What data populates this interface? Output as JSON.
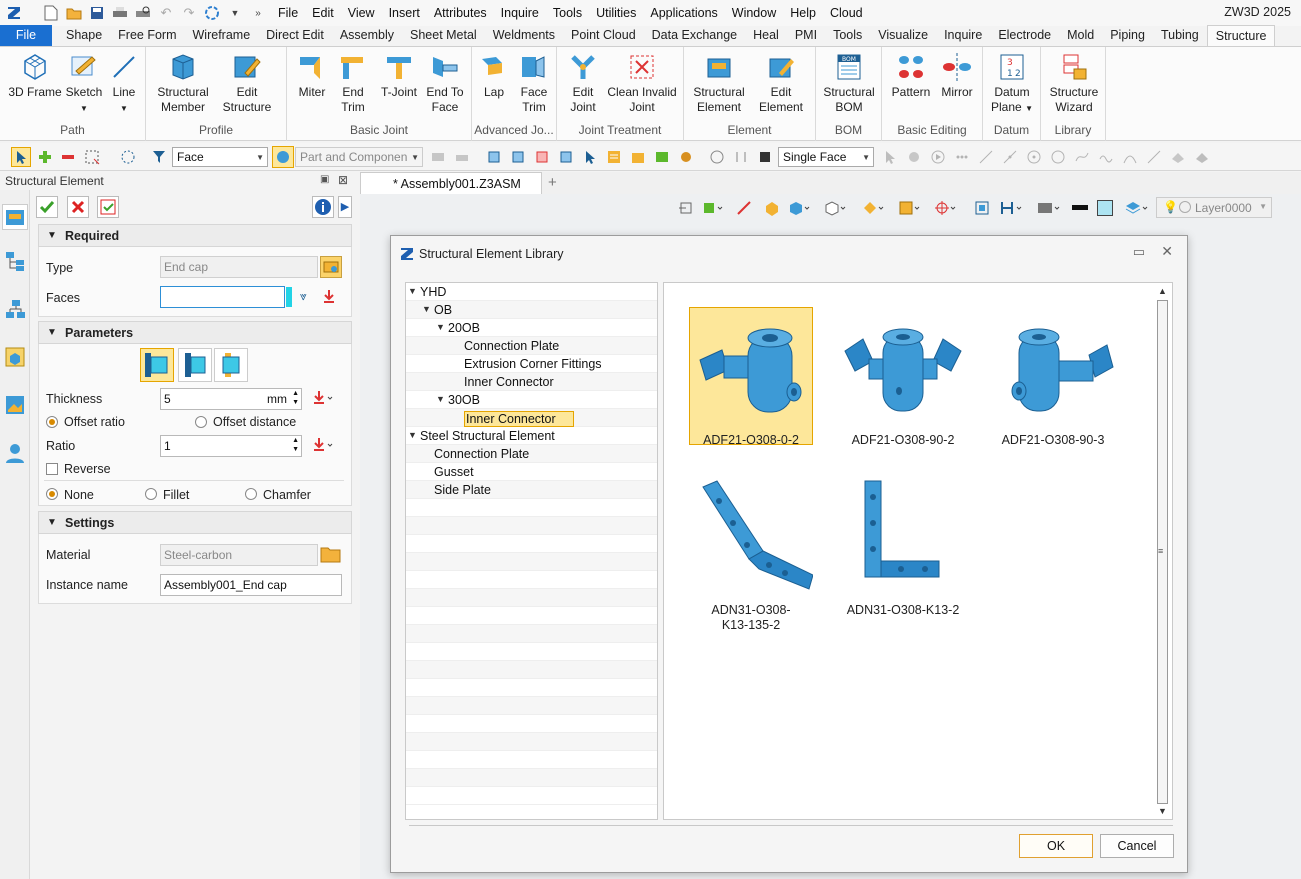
{
  "app": {
    "name": "ZW3D 2025"
  },
  "menubar": {
    "items": [
      "File",
      "Edit",
      "View",
      "Insert",
      "Attributes",
      "Inquire",
      "Tools",
      "Utilities",
      "Applications",
      "Window",
      "Help",
      "Cloud"
    ]
  },
  "ribbon_tabs": [
    "File",
    "Shape",
    "Free Form",
    "Wireframe",
    "Direct Edit",
    "Assembly",
    "Sheet Metal",
    "Weldments",
    "Point Cloud",
    "Data Exchange",
    "Heal",
    "PMI",
    "Tools",
    "Visualize",
    "Inquire",
    "Electrode",
    "Mold",
    "Piping",
    "Tubing",
    "Structure"
  ],
  "ribbon": {
    "groups": [
      {
        "name": "Path",
        "buttons": [
          "3D Frame",
          "Sketch",
          "Line"
        ]
      },
      {
        "name": "Profile",
        "buttons": [
          "Structural Member",
          "Edit Structure"
        ]
      },
      {
        "name": "Basic Joint",
        "buttons": [
          "Miter",
          "End Trim",
          "T-Joint",
          "End To Face"
        ]
      },
      {
        "name": "Advanced Jo...",
        "buttons": [
          "Lap",
          "Face Trim"
        ]
      },
      {
        "name": "Joint Treatment",
        "buttons": [
          "Edit Joint",
          "Clean Invalid Joint"
        ]
      },
      {
        "name": "Element",
        "buttons": [
          "Structural Element",
          "Edit Element"
        ]
      },
      {
        "name": "BOM",
        "buttons": [
          "Structural BOM"
        ]
      },
      {
        "name": "Basic Editing",
        "buttons": [
          "Pattern",
          "Mirror"
        ]
      },
      {
        "name": "Datum",
        "buttons": [
          "Datum Plane"
        ]
      },
      {
        "name": "Library",
        "buttons": [
          "Structure Wizard"
        ]
      }
    ],
    "bom_badge": "BOM",
    "datum_digits": [
      "3",
      "1",
      "2"
    ]
  },
  "toolbar": {
    "filter": "Face",
    "part_filter": "Part and Componen",
    "pick_mode": "Single Face"
  },
  "view_toolbar": {
    "layer": "Layer0000"
  },
  "panel": {
    "title": "Structural Element",
    "sections": {
      "required": "Required",
      "parameters": "Parameters",
      "settings": "Settings"
    },
    "type_label": "Type",
    "type_value": "End cap",
    "faces_label": "Faces",
    "faces_value": "",
    "thickness_label": "Thickness",
    "thickness_value": "5",
    "thickness_unit": "mm",
    "offset_ratio": "Offset ratio",
    "offset_distance": "Offset distance",
    "ratio_label": "Ratio",
    "ratio_value": "1",
    "reverse_label": "Reverse",
    "corner_none": "None",
    "corner_fillet": "Fillet",
    "corner_chamfer": "Chamfer",
    "material_label": "Material",
    "material_value": "Steel-carbon",
    "instance_label": "Instance name",
    "instance_value": "Assembly001_End cap"
  },
  "document": {
    "tab": "* Assembly001.Z3ASM"
  },
  "dialog": {
    "title": "Structural Element Library",
    "tree": [
      {
        "label": "YHD",
        "level": 0,
        "expanded": true
      },
      {
        "label": "OB",
        "level": 1,
        "expanded": true
      },
      {
        "label": "20OB",
        "level": 2,
        "expanded": true
      },
      {
        "label": "Connection Plate",
        "level": 3
      },
      {
        "label": "Extrusion Corner Fittings",
        "level": 3
      },
      {
        "label": "Inner Connector",
        "level": 3
      },
      {
        "label": "30OB",
        "level": 2,
        "expanded": true
      },
      {
        "label": "Inner Connector",
        "level": 3,
        "selected": true
      },
      {
        "label": "Steel Structural Element",
        "level": 0,
        "expanded": true
      },
      {
        "label": "Connection Plate",
        "level": 1
      },
      {
        "label": "Gusset",
        "level": 1
      },
      {
        "label": "Side Plate",
        "level": 1
      }
    ],
    "items": [
      {
        "name": "ADF21-O308-0-2",
        "selected": true
      },
      {
        "name": "ADF21-O308-90-2"
      },
      {
        "name": "ADF21-O308-90-3"
      },
      {
        "name_lines": [
          "ADN31-O308-",
          "K13-135-2"
        ]
      },
      {
        "name": "ADN31-O308-K13-2"
      }
    ],
    "ok": "OK",
    "cancel": "Cancel"
  },
  "colors": {
    "accent": "#1a6fd1",
    "selection": "#fde79a",
    "part": "#3d9ad6"
  }
}
